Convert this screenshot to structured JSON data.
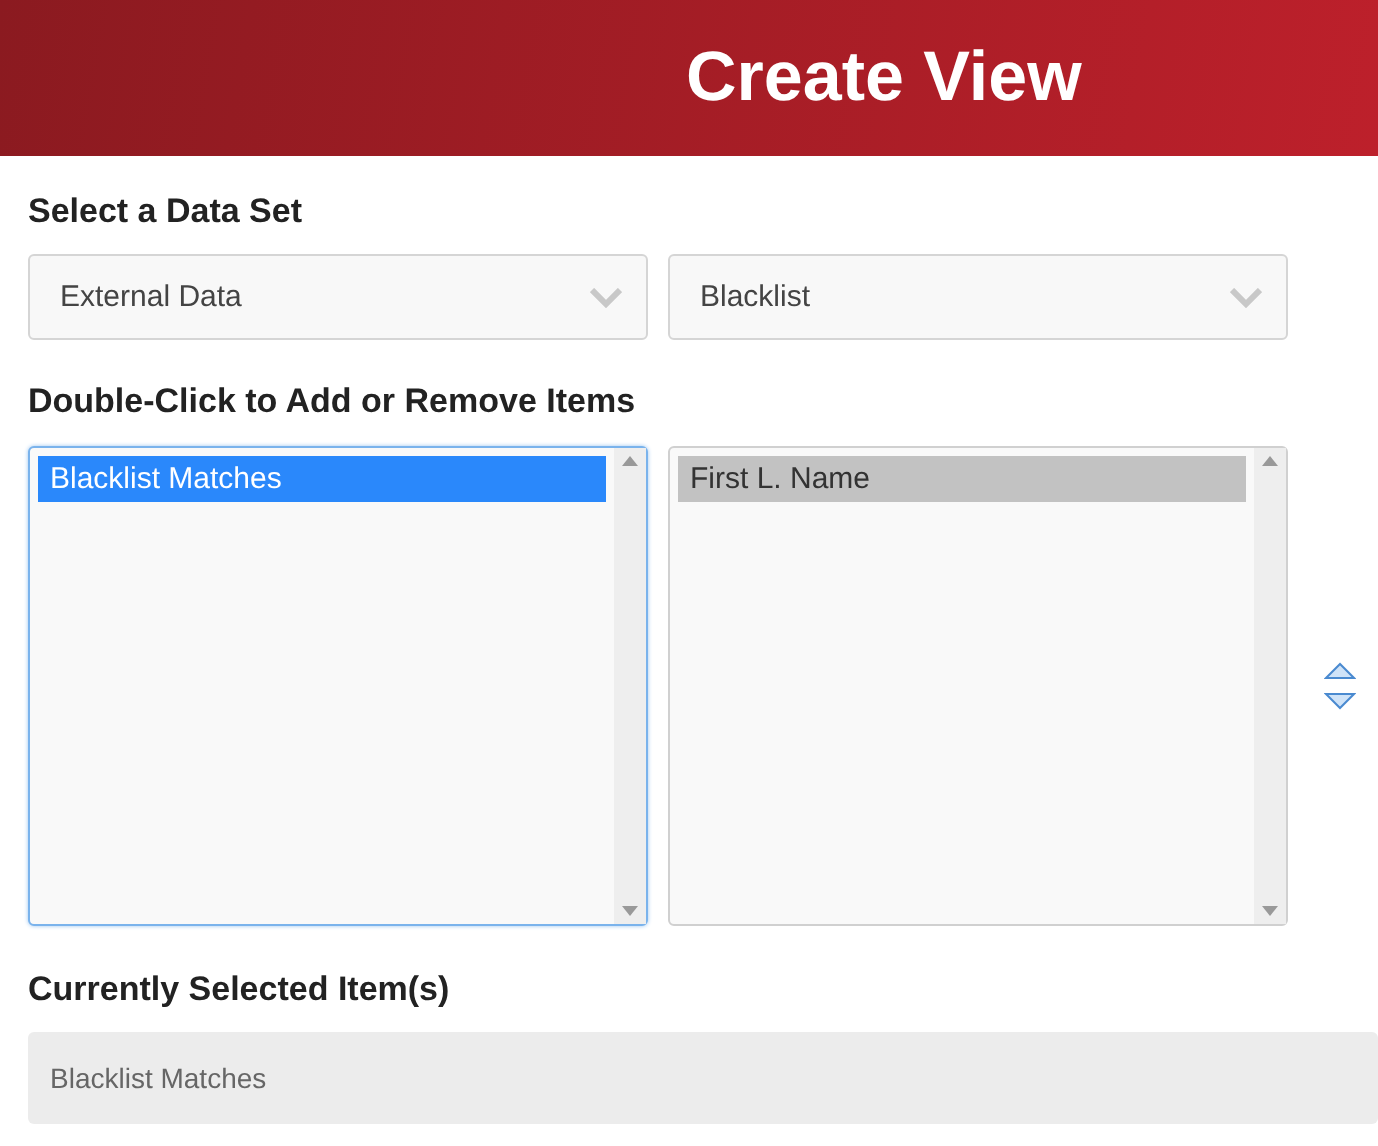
{
  "header": {
    "title": "Create View"
  },
  "data_set": {
    "label": "Select a Data Set",
    "selects": [
      {
        "value": "External Data"
      },
      {
        "value": "Blacklist"
      }
    ]
  },
  "items": {
    "label": "Double-Click to Add or Remove Items",
    "lists": [
      {
        "focused": true,
        "items": [
          {
            "label": "Blacklist Matches",
            "selected": true
          }
        ]
      },
      {
        "focused": false,
        "items": [
          {
            "label": "First L. Name",
            "selected": true
          }
        ]
      }
    ]
  },
  "current": {
    "label": "Currently Selected Item(s)",
    "value": "Blacklist Matches"
  }
}
